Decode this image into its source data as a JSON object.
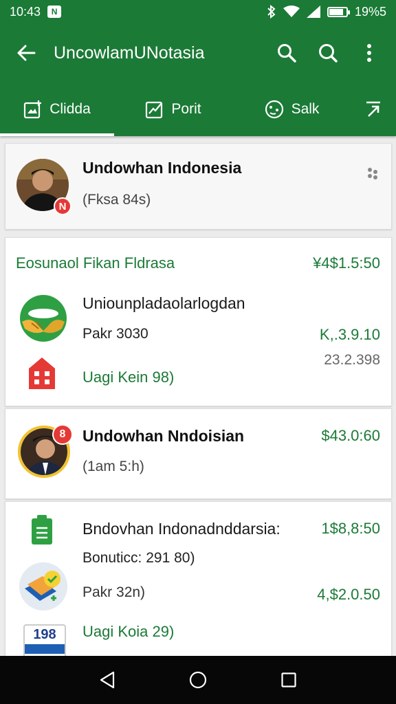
{
  "status_bar": {
    "time": "10:43",
    "battery_text": "19%5",
    "battery_level": 0.85,
    "app_icon_letter": "N"
  },
  "app_bar": {
    "title": "UncowlamUNotasia"
  },
  "tabs": [
    {
      "label": "Clidda",
      "active": true
    },
    {
      "label": "Porit",
      "active": false
    },
    {
      "label": "Salk",
      "active": false
    },
    {
      "label": "",
      "active": false
    }
  ],
  "profile": {
    "name": "Undowhan Indonesia",
    "subtitle": "(Fksa 84s)",
    "badge": "N"
  },
  "card2": {
    "heading": "Eosunaol Fikan Fldrasa",
    "heading_price": "¥4$1.5:50",
    "title": "Uniounpladaolarlogdan",
    "subtitle": "Pakr 3030",
    "price": "K,.3.9.10",
    "price2": "23.2.398",
    "link": "Uagi Kein 98)"
  },
  "card3": {
    "name": "Undowhan Nndoisian",
    "subtitle": "(1am 5:h)",
    "price": "$43.0:60",
    "badge": "8"
  },
  "card4": {
    "title": "Bndovhan Indonadnddarsia:",
    "price": "1$8,8:50",
    "subtitle": "Bonuticc: 291 80)",
    "detail": "Pakr 32n)",
    "price2": "4,$2.0.50",
    "link": "Uagi Koia 29)",
    "icon_label": "198"
  },
  "colors": {
    "primary": "#1b7a36",
    "badge": "#e53935"
  }
}
